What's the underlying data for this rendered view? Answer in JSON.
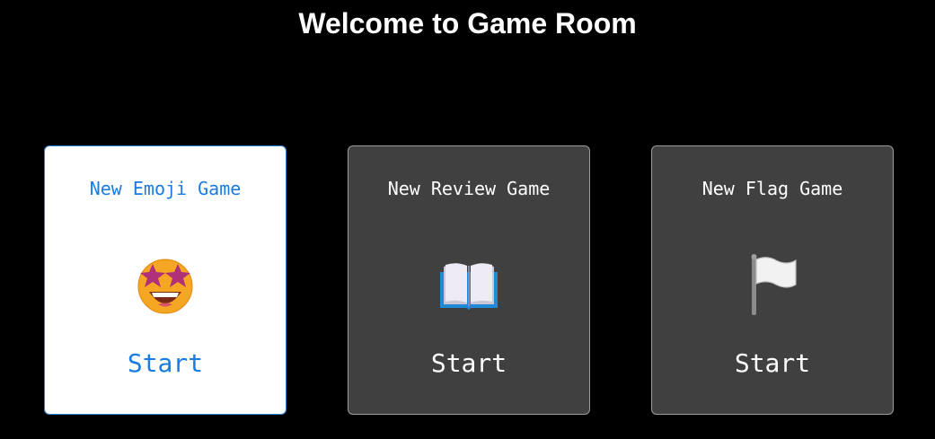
{
  "header": {
    "title": "Welcome to Game Room"
  },
  "cards": [
    {
      "title": "New Emoji Game",
      "icon": "star-struck-face-icon",
      "start_label": "Start",
      "selected": true,
      "accent_color": "#1a7ce0"
    },
    {
      "title": "New Review Game",
      "icon": "open-book-icon",
      "start_label": "Start",
      "selected": false
    },
    {
      "title": "New Flag Game",
      "icon": "white-flag-icon",
      "start_label": "Start",
      "selected": false
    }
  ],
  "colors": {
    "background": "#000000",
    "card_background": "#404040",
    "card_selected_background": "#ffffff",
    "text": "#ffffff"
  }
}
